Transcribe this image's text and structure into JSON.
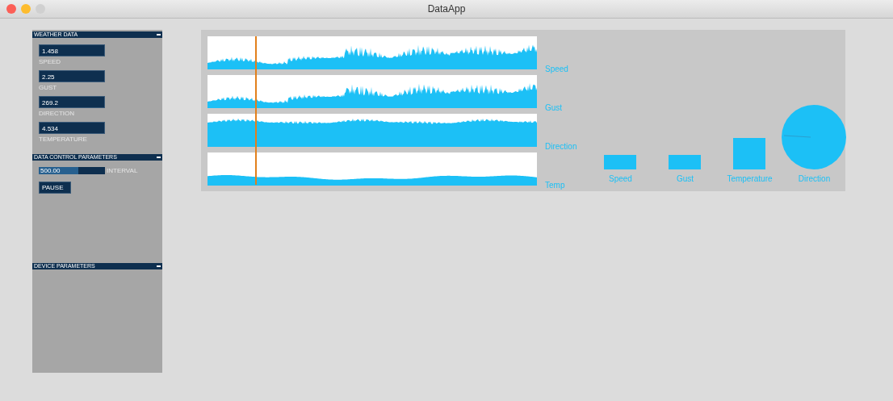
{
  "window": {
    "title": "DataApp"
  },
  "sidebar": {
    "groups": [
      {
        "title": "WEATHER DATA",
        "expanded": true,
        "fields": [
          {
            "value": "1.458",
            "label": "SPEED"
          },
          {
            "value": "2.25",
            "label": "GUST"
          },
          {
            "value": "269.2",
            "label": "DIRECTION"
          },
          {
            "value": "4.534",
            "label": "TEMPERATURE"
          }
        ]
      },
      {
        "title": "DATA CONTROL PARAMETERS",
        "expanded": true,
        "slider": {
          "value": "500.00",
          "label": "INTERVAL",
          "level": 0.6
        },
        "button": "PAUSE"
      },
      {
        "title": "DEVICE PARAMETERS",
        "expanded": true
      }
    ]
  },
  "traces": [
    {
      "label": "Speed",
      "kind": "spiky"
    },
    {
      "label": "Gust",
      "kind": "spiky"
    },
    {
      "label": "Direction",
      "kind": "high"
    },
    {
      "label": "Temp",
      "kind": "low"
    }
  ],
  "gauges": [
    {
      "label": "Speed",
      "kind": "bar"
    },
    {
      "label": "Gust",
      "kind": "bar"
    },
    {
      "label": "Temperature",
      "kind": "square"
    },
    {
      "label": "Direction",
      "kind": "dial"
    }
  ]
}
